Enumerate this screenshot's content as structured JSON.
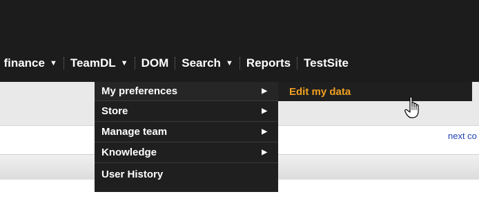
{
  "menubar": {
    "items": [
      {
        "label": ", finance",
        "caret": "▼"
      },
      {
        "label": "TeamDL",
        "caret": "▼"
      },
      {
        "label": "DOM",
        "caret": ""
      },
      {
        "label": "Search",
        "caret": "▼"
      },
      {
        "label": "Reports",
        "caret": ""
      },
      {
        "label": "TestSite",
        "caret": ""
      }
    ]
  },
  "dropdown": {
    "items": [
      {
        "label": "My preferences",
        "arrow": "▶"
      },
      {
        "label": "Store",
        "arrow": "▶"
      },
      {
        "label": "Manage team",
        "arrow": "▶"
      },
      {
        "label": "Knowledge",
        "arrow": "▶"
      },
      {
        "label": "User History",
        "arrow": ""
      }
    ]
  },
  "submenu": {
    "item": "Edit my data"
  },
  "page": {
    "next_link": "next co"
  },
  "colors": {
    "header_bg": "#1c1c1c",
    "submenu_text": "#f0a020",
    "link": "#1f3fb8"
  }
}
